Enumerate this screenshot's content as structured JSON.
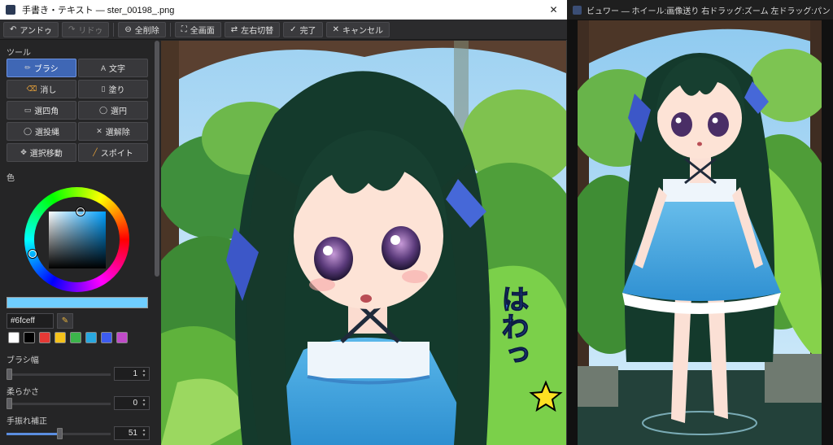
{
  "left_window": {
    "title": "手書き・テキスト — ster_00198_.png",
    "close_glyph": "✕",
    "toolbar": {
      "undo": "アンドゥ",
      "redo": "リドゥ",
      "clear_all": "全削除",
      "fullscreen": "全画面",
      "swap_lr": "左右切替",
      "done": "完了",
      "cancel": "キャンセル"
    },
    "panel": {
      "tools_heading": "ツール",
      "tools": [
        {
          "label": "ブラシ",
          "icon": "brush-icon"
        },
        {
          "label": "文字",
          "icon": "text-icon"
        },
        {
          "label": "消し",
          "icon": "eraser-icon"
        },
        {
          "label": "塗り",
          "icon": "fill-icon"
        },
        {
          "label": "選四角",
          "icon": "rect-select-icon"
        },
        {
          "label": "選円",
          "icon": "ellipse-select-icon"
        },
        {
          "label": "選投縄",
          "icon": "lasso-icon"
        },
        {
          "label": "選解除",
          "icon": "deselect-icon"
        },
        {
          "label": "選択移動",
          "icon": "move-icon"
        },
        {
          "label": "スポイト",
          "icon": "eyedropper-icon"
        }
      ],
      "active_tool": "ブラシ",
      "color_heading": "色",
      "current_color": "#6fceff",
      "hex_value": "#6fceff",
      "swatches": [
        "#ffffff",
        "#000000",
        "#e53935",
        "#f5c21b",
        "#3cb44b",
        "#29a8e0",
        "#3d5cf0",
        "#c04bc8"
      ],
      "brush_width": {
        "label": "ブラシ幅",
        "value": "1",
        "fraction": 0.0
      },
      "softness": {
        "label": "柔らかさ",
        "value": "0",
        "fraction": 0.0
      },
      "stabilizer": {
        "label": "手振れ補正",
        "value": "51",
        "fraction": 0.51
      }
    },
    "canvas_text": "はわっ"
  },
  "right_window": {
    "title": "ビュワー — ホイール:画像送り 右ドラッグ:ズーム 左ドラッグ:パン 中ボタン:ズームリ..."
  }
}
